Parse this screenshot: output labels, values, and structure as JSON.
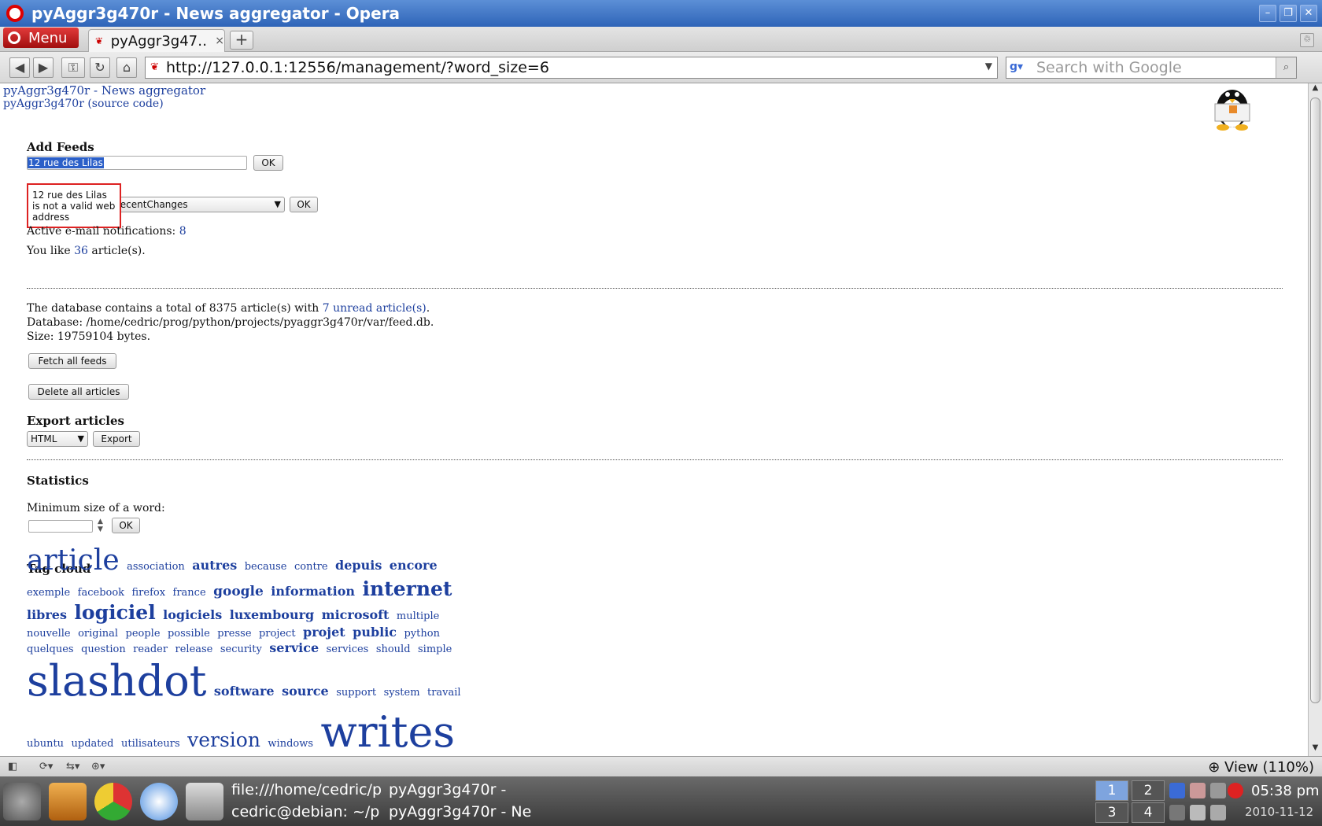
{
  "window": {
    "title": "pyAggr3g470r - News aggregator - Opera",
    "min": "–",
    "max": "❐",
    "close": "✕"
  },
  "tabs": {
    "menu_label": "Menu",
    "active_tab": "pyAggr3g47…",
    "close": "×",
    "new_tab": "+"
  },
  "navbar": {
    "url": "http://127.0.0.1:12556/management/?word_size=6",
    "search_placeholder": "Search with Google",
    "back": "◀",
    "forward": "▶",
    "wand": "⚿",
    "reload": "↻",
    "home": "⌂"
  },
  "page": {
    "site_title": "pyAggr3g470r - News aggregator",
    "site_link": "pyAggr3g470r",
    "source_code": "(source code)",
    "add_feeds_title": "Add Feeds",
    "add_feed_value": "12 rue des Lilas",
    "ok": "OK",
    "tooltip": "12 rue des Lilas is not a valid web address",
    "select_partial": "RecentChanges",
    "active_notifications_label": "Active e-mail notifications:",
    "active_notifications_count": "8",
    "you_like_prefix": "You like",
    "you_like_count": "36",
    "you_like_suffix": "article(s).",
    "db_total_prefix": "The database contains a total of 8375 article(s) with",
    "db_unread": "7 unread article(s)",
    "db_path": "Database: /home/cedric/prog/python/projects/pyaggr3g470r/var/feed.db.",
    "db_size": "Size: 19759104 bytes.",
    "fetch_all": "Fetch all feeds",
    "delete_all": "Delete all articles",
    "export_title": "Export articles",
    "export_format": "HTML",
    "export_btn": "Export",
    "statistics_title": "Statistics",
    "min_word_label": "Minimum size of a word:",
    "tag_cloud_title": "Tag cloud"
  },
  "tag_cloud": [
    {
      "word": "article",
      "size": 36
    },
    {
      "word": "association",
      "size": 13
    },
    {
      "word": "autres",
      "size": 16,
      "bold": true
    },
    {
      "word": "because",
      "size": 13
    },
    {
      "word": "contre",
      "size": 13
    },
    {
      "word": "depuis",
      "size": 16,
      "bold": true
    },
    {
      "word": "encore",
      "size": 16,
      "bold": true
    },
    {
      "word": "exemple",
      "size": 13
    },
    {
      "word": "facebook",
      "size": 13
    },
    {
      "word": "firefox",
      "size": 13
    },
    {
      "word": "france",
      "size": 13
    },
    {
      "word": "google",
      "size": 17,
      "bold": true
    },
    {
      "word": "information",
      "size": 16,
      "bold": true
    },
    {
      "word": "internet",
      "size": 25,
      "bold": true
    },
    {
      "word": "libres",
      "size": 16,
      "bold": true
    },
    {
      "word": "logiciel",
      "size": 25,
      "bold": true
    },
    {
      "word": "logiciels",
      "size": 16,
      "bold": true
    },
    {
      "word": "luxembourg",
      "size": 16,
      "bold": true
    },
    {
      "word": "microsoft",
      "size": 16,
      "bold": true
    },
    {
      "word": "multiple",
      "size": 13
    },
    {
      "word": "nouvelle",
      "size": 13
    },
    {
      "word": "original",
      "size": 13
    },
    {
      "word": "people",
      "size": 13
    },
    {
      "word": "possible",
      "size": 13
    },
    {
      "word": "presse",
      "size": 13
    },
    {
      "word": "project",
      "size": 13
    },
    {
      "word": "projet",
      "size": 16,
      "bold": true
    },
    {
      "word": "public",
      "size": 16,
      "bold": true
    },
    {
      "word": "python",
      "size": 13
    },
    {
      "word": "quelques",
      "size": 13
    },
    {
      "word": "question",
      "size": 13
    },
    {
      "word": "reader",
      "size": 13
    },
    {
      "word": "release",
      "size": 13
    },
    {
      "word": "security",
      "size": 13
    },
    {
      "word": "service",
      "size": 16,
      "bold": true
    },
    {
      "word": "services",
      "size": 13
    },
    {
      "word": "should",
      "size": 13
    },
    {
      "word": "simple",
      "size": 13
    },
    {
      "word": "slashdot",
      "size": 54
    },
    {
      "word": "software",
      "size": 16,
      "bold": true
    },
    {
      "word": "source",
      "size": 16,
      "bold": true
    },
    {
      "word": "support",
      "size": 13
    },
    {
      "word": "system",
      "size": 13
    },
    {
      "word": "travail",
      "size": 13
    },
    {
      "word": "ubuntu",
      "size": 13
    },
    {
      "word": "updated",
      "size": 13
    },
    {
      "word": "utilisateurs",
      "size": 13
    },
    {
      "word": "version",
      "size": 25
    },
    {
      "word": "windows",
      "size": 13
    },
    {
      "word": "writes",
      "size": 54
    }
  ],
  "statusbar": {
    "zoom": "View (110%)"
  },
  "taskbar": {
    "task1_line1": "file:///home/cedric/p",
    "task1_line2": "cedric@debian: ~/p",
    "task2_line1": "pyAggr3g470r -",
    "task2_line2": "pyAggr3g470r - Ne",
    "desktops": [
      "1",
      "2",
      "3",
      "4"
    ],
    "clock": "05:38 pm",
    "date": "2010-11-12"
  }
}
